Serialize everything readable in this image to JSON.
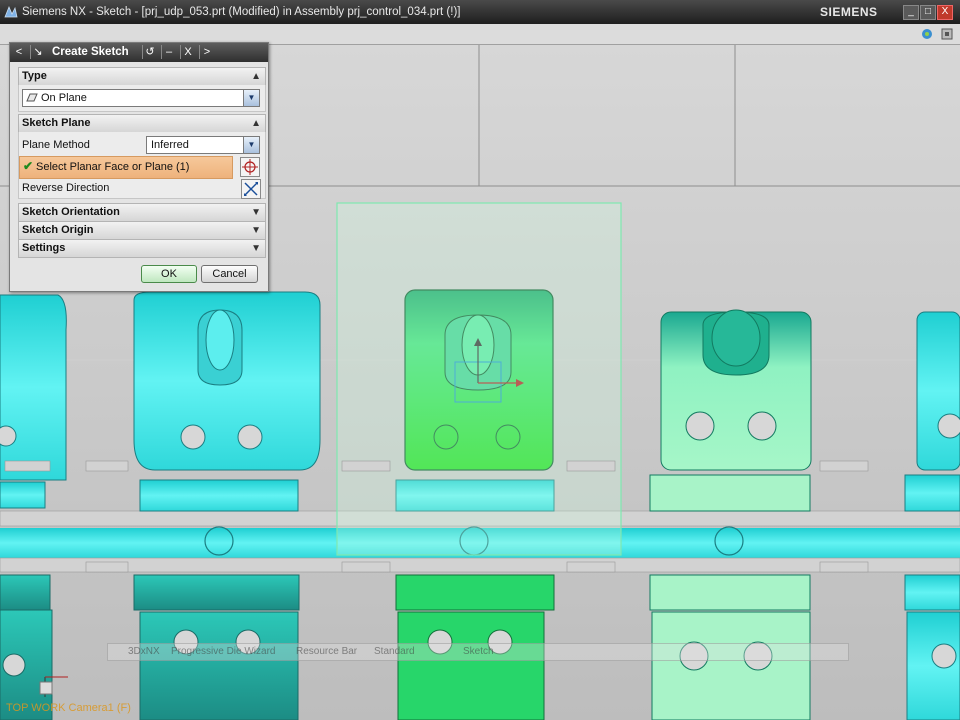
{
  "window": {
    "title": "Siemens NX - Sketch - [prj_udp_053.prt (Modified)  in Assembly prj_control_034.prt   (!)]",
    "brand": "SIEMENS",
    "controls": [
      "_",
      "□",
      "X"
    ]
  },
  "dialog": {
    "title": "Create Sketch",
    "header_buttons": [
      "<",
      "↘",
      "↺",
      "–",
      "X",
      ">"
    ],
    "type_section": {
      "label": "Type",
      "value": "On Plane"
    },
    "sketch_plane": {
      "label": "Sketch Plane",
      "plane_method_label": "Plane Method",
      "plane_method_value": "Inferred",
      "select_label": "Select Planar Face or Plane (1)",
      "reverse_label": "Reverse Direction"
    },
    "collapsed_sections": [
      {
        "label": "Sketch Orientation"
      },
      {
        "label": "Sketch Origin"
      },
      {
        "label": "Settings"
      }
    ],
    "ok_label": "OK",
    "cancel_label": "Cancel"
  },
  "ghost_toolbar": {
    "items": [
      "3DxNX",
      "Progressive Die Wizard",
      "Resource Bar",
      "Standard",
      "Sketch"
    ]
  },
  "viewport_label": "TOP WORK Camera1 (F)",
  "colors": {
    "background": "#c9c9c9",
    "part_cyan": "#33e6e6",
    "selected_green": "#22dd22",
    "highlight_row": "#f0b884"
  },
  "icons": {
    "type_icon": "plane-icon",
    "select_icon": "crosshair-icon",
    "reverse_icon": "reverse-direction-icon"
  }
}
